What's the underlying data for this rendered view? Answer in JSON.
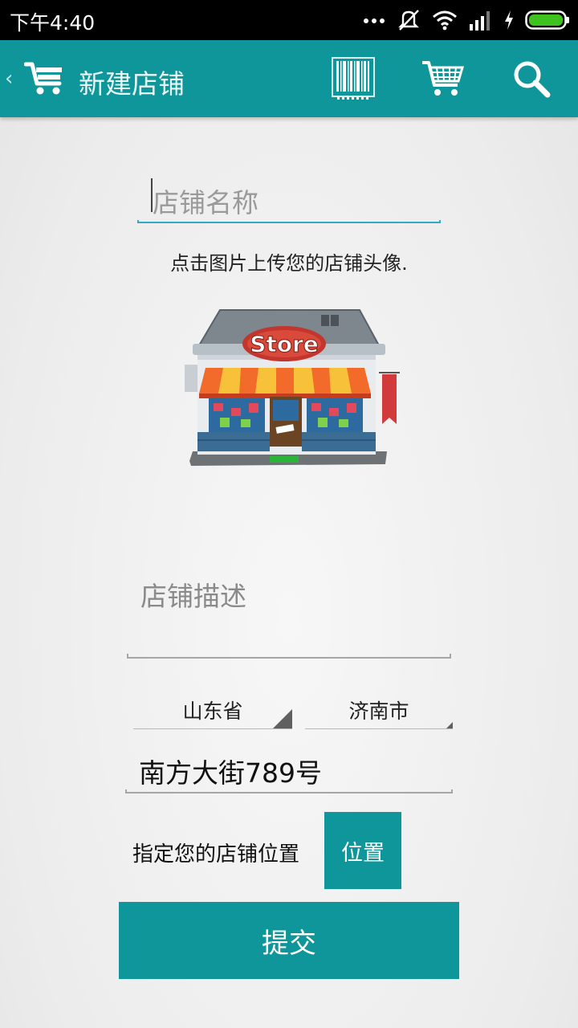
{
  "status_bar": {
    "time": "下午4:40",
    "icons": [
      "more-dots-icon",
      "silent-mode-icon",
      "wifi-icon",
      "signal-icon",
      "charging-icon",
      "battery-icon"
    ]
  },
  "app_bar": {
    "title": "新建店铺",
    "background_color": "#0e969a",
    "actions": [
      "barcode-scan-icon",
      "shopping-cart-icon",
      "search-icon"
    ]
  },
  "form": {
    "store_name_placeholder": "店铺名称",
    "upload_hint": "点击图片上传您的店铺头像.",
    "store_image_sign": "Store",
    "description_placeholder": "店铺描述",
    "province": "山东省",
    "city": "济南市",
    "address": "南方大街789号",
    "location_label": "指定您的店铺位置",
    "location_button": "位置",
    "submit_button": "提交"
  },
  "colors": {
    "accent": "#0e969a",
    "focus_underline": "#33a8c8"
  }
}
